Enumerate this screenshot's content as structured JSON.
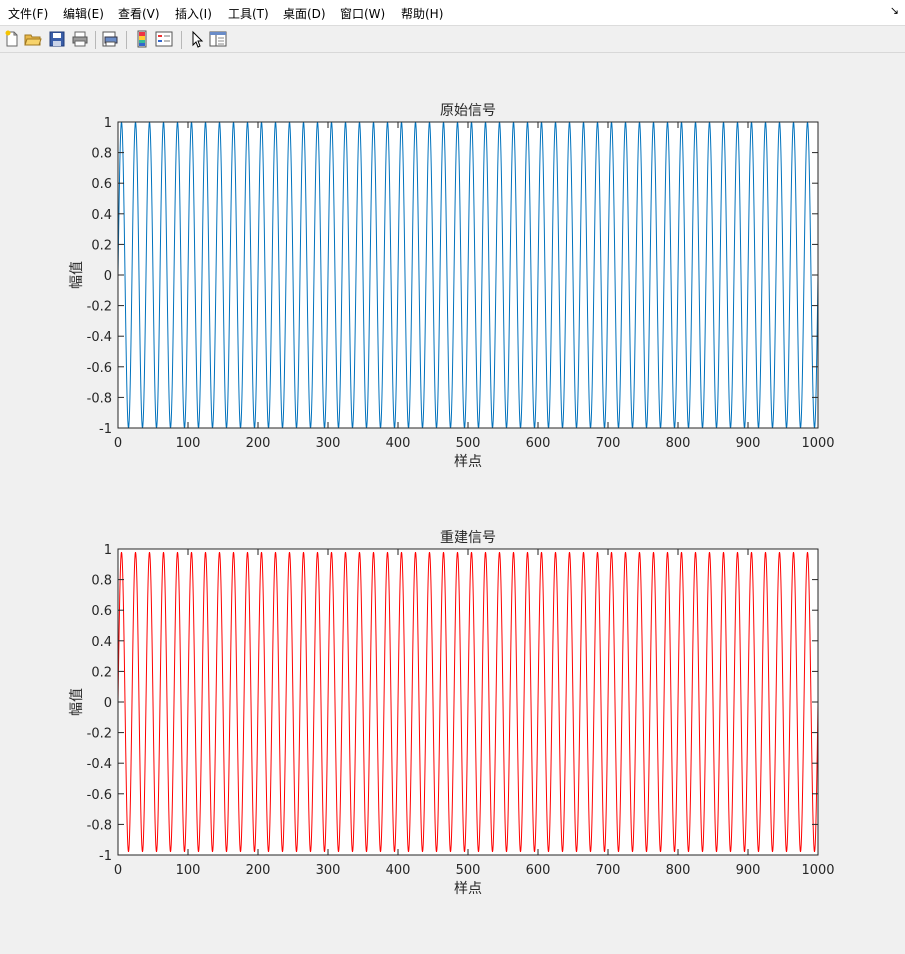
{
  "menubar": {
    "items": [
      "文件(F)",
      "编辑(E)",
      "查看(V)",
      "插入(I)",
      "工具(T)",
      "桌面(D)",
      "窗口(W)",
      "帮助(H)"
    ],
    "dock_arrow": "↘"
  },
  "toolbar": {
    "buttons": [
      "new-figure-icon",
      "open-folder-icon",
      "save-icon",
      "print-icon",
      "print-preview-icon",
      "colorbar-icon",
      "legend-icon",
      "pointer-icon",
      "property-editor-icon"
    ]
  },
  "colors": {
    "original": "#0072BD",
    "reconstructed": "#FF0000"
  },
  "chart_data": [
    {
      "type": "line",
      "title": "原始信号",
      "xlabel": "样点",
      "ylabel": "幅值",
      "xlim": [
        0,
        1000
      ],
      "ylim": [
        -1,
        1
      ],
      "xticks": [
        0,
        100,
        200,
        300,
        400,
        500,
        600,
        700,
        800,
        900,
        1000
      ],
      "yticks": [
        1,
        0.8,
        0.6,
        0.4,
        0.2,
        0,
        -0.2,
        -0.4,
        -0.6,
        -0.8,
        -1
      ],
      "ytick_labels": [
        "1",
        "0.8",
        "0.6",
        "0.4",
        "0.2",
        "0",
        "-0.2",
        "-0.4",
        "-0.6",
        "-0.8",
        "-1"
      ],
      "series": [
        {
          "function": "sin",
          "period": 20,
          "amplitude": 1,
          "x_start": 0,
          "x_end": 1000,
          "color": "#0072BD"
        }
      ]
    },
    {
      "type": "line",
      "title": "重建信号",
      "xlabel": "样点",
      "ylabel": "幅值",
      "xlim": [
        0,
        1000
      ],
      "ylim": [
        -1,
        1
      ],
      "xticks": [
        0,
        100,
        200,
        300,
        400,
        500,
        600,
        700,
        800,
        900,
        1000
      ],
      "yticks": [
        1,
        0.8,
        0.6,
        0.4,
        0.2,
        0,
        -0.2,
        -0.4,
        -0.6,
        -0.8,
        -1
      ],
      "ytick_labels": [
        "1",
        "0.8",
        "0.6",
        "0.4",
        "0.2",
        "0",
        "-0.2",
        "-0.4",
        "-0.6",
        "-0.8",
        "-1"
      ],
      "series": [
        {
          "function": "sin",
          "period": 20,
          "amplitude": 0.98,
          "x_start": 0,
          "x_end": 1000,
          "color": "#FF0000"
        }
      ]
    }
  ]
}
